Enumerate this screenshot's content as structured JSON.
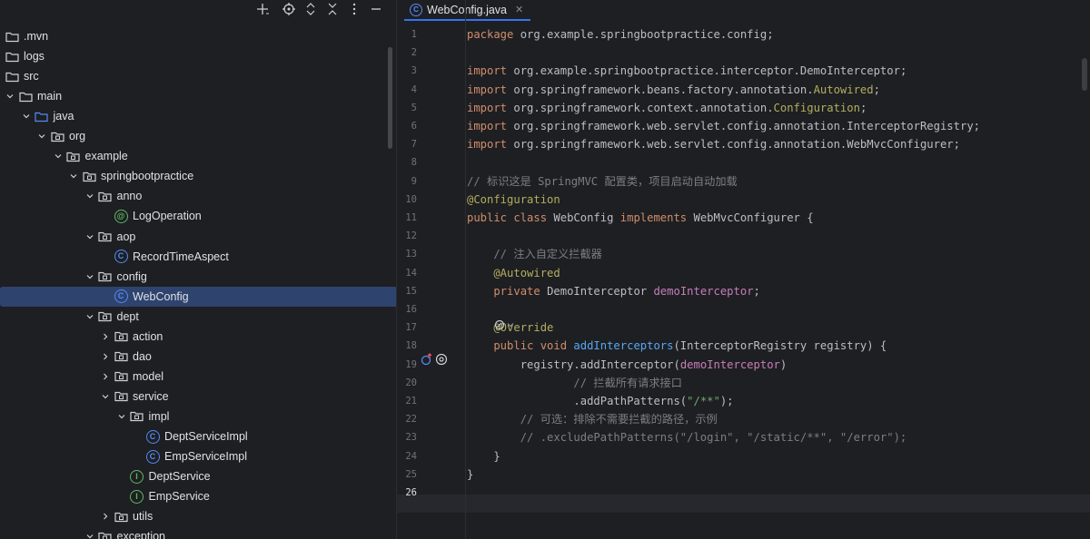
{
  "project": {
    "toolbar": [
      "add",
      "locate",
      "expand",
      "collapse",
      "options",
      "hide"
    ],
    "tree": [
      {
        "depth": 0,
        "expanded": null,
        "icon": "folder",
        "label": ".mvn"
      },
      {
        "depth": 0,
        "expanded": null,
        "icon": "folder",
        "label": "logs"
      },
      {
        "depth": 0,
        "expanded": null,
        "icon": "folder",
        "label": "src"
      },
      {
        "depth": 0,
        "expanded": true,
        "icon": "folder",
        "label": "main"
      },
      {
        "depth": 1,
        "expanded": true,
        "icon": "source-folder",
        "label": "java"
      },
      {
        "depth": 2,
        "expanded": true,
        "icon": "package",
        "label": "org"
      },
      {
        "depth": 3,
        "expanded": true,
        "icon": "package",
        "label": "example"
      },
      {
        "depth": 4,
        "expanded": true,
        "icon": "package",
        "label": "springbootpractice"
      },
      {
        "depth": 5,
        "expanded": true,
        "icon": "package",
        "label": "anno"
      },
      {
        "depth": 6,
        "expanded": null,
        "icon": "annotation",
        "label": "LogOperation"
      },
      {
        "depth": 5,
        "expanded": true,
        "icon": "package",
        "label": "aop"
      },
      {
        "depth": 6,
        "expanded": null,
        "icon": "class",
        "label": "RecordTimeAspect"
      },
      {
        "depth": 5,
        "expanded": true,
        "icon": "package",
        "label": "config"
      },
      {
        "depth": 6,
        "expanded": null,
        "icon": "class",
        "label": "WebConfig",
        "selected": true
      },
      {
        "depth": 5,
        "expanded": true,
        "icon": "package",
        "label": "dept"
      },
      {
        "depth": 6,
        "expanded": false,
        "icon": "package",
        "label": "action"
      },
      {
        "depth": 6,
        "expanded": false,
        "icon": "package",
        "label": "dao"
      },
      {
        "depth": 6,
        "expanded": false,
        "icon": "package",
        "label": "model"
      },
      {
        "depth": 6,
        "expanded": true,
        "icon": "package",
        "label": "service"
      },
      {
        "depth": 7,
        "expanded": true,
        "icon": "package",
        "label": "impl"
      },
      {
        "depth": 8,
        "expanded": null,
        "icon": "class",
        "label": "DeptServiceImpl"
      },
      {
        "depth": 8,
        "expanded": null,
        "icon": "class",
        "label": "EmpServiceImpl"
      },
      {
        "depth": 7,
        "expanded": null,
        "icon": "interface",
        "label": "DeptService"
      },
      {
        "depth": 7,
        "expanded": null,
        "icon": "interface",
        "label": "EmpService"
      },
      {
        "depth": 6,
        "expanded": false,
        "icon": "package",
        "label": "utils"
      },
      {
        "depth": 5,
        "expanded": true,
        "icon": "package",
        "label": "exception"
      }
    ]
  },
  "editor": {
    "tab": {
      "label": "WebConfig.java",
      "icon": "class-icon"
    },
    "current_line": 26,
    "lines": [
      [
        [
          "kw",
          "package "
        ],
        [
          "",
          "org.example.springbootpractice.config;"
        ]
      ],
      [],
      [
        [
          "kw",
          "import "
        ],
        [
          "",
          "org.example.springbootpractice.interceptor.DemoInterceptor;"
        ]
      ],
      [
        [
          "kw",
          "import "
        ],
        [
          "",
          "org.springframework.beans.factory.annotation."
        ],
        [
          "ann",
          "Autowired"
        ],
        [
          "",
          ";"
        ]
      ],
      [
        [
          "kw",
          "import "
        ],
        [
          "",
          "org.springframework.context.annotation."
        ],
        [
          "ann",
          "Configuration"
        ],
        [
          "",
          ";"
        ]
      ],
      [
        [
          "kw",
          "import "
        ],
        [
          "",
          "org.springframework.web.servlet.config.annotation.InterceptorRegistry;"
        ]
      ],
      [
        [
          "kw",
          "import "
        ],
        [
          "",
          "org.springframework.web.servlet.config.annotation.WebMvcConfigurer;"
        ]
      ],
      [],
      [
        [
          "cmt",
          "// 标识这是 SpringMVC 配置类，项目启动自动加载"
        ]
      ],
      [
        [
          "ann",
          "@Configuration"
        ]
      ],
      [
        [
          "kw",
          "public class "
        ],
        [
          "",
          "WebConfig "
        ],
        [
          "kw",
          "implements "
        ],
        [
          "",
          "WebMvcConfigurer {"
        ]
      ],
      [],
      [
        [
          "cmt",
          "    // 注入自定义拦截器"
        ]
      ],
      [
        [
          "ann",
          "    @Autowired"
        ]
      ],
      [
        [
          "kw",
          "    private "
        ],
        [
          "",
          "DemoInterceptor "
        ],
        [
          "fld",
          "demoInterceptor"
        ],
        [
          "",
          ";"
        ]
      ],
      [],
      [
        [
          "ann",
          "    @Override"
        ]
      ],
      [
        [
          "kw",
          "    public void "
        ],
        [
          "fn",
          "addInterceptors"
        ],
        [
          "",
          "(InterceptorRegistry registry) {"
        ]
      ],
      [
        [
          "",
          "        registry.addInterceptor("
        ],
        [
          "fld",
          "demoInterceptor"
        ],
        [
          "",
          ")"
        ]
      ],
      [
        [
          "cmt",
          "                // 拦截所有请求接口"
        ]
      ],
      [
        [
          "",
          "                .addPathPatterns("
        ],
        [
          "str",
          "\"/**\""
        ],
        [
          "",
          ");"
        ]
      ],
      [
        [
          "cmt",
          "        // 可选：排除不需要拦截的路径，示例"
        ]
      ],
      [
        [
          "cmt",
          "        // .excludePathPatterns(\"/login\", \"/static/**\", \"/error\");"
        ]
      ],
      [
        [
          "",
          "    }"
        ]
      ],
      [
        [
          "",
          "}"
        ]
      ],
      []
    ]
  }
}
